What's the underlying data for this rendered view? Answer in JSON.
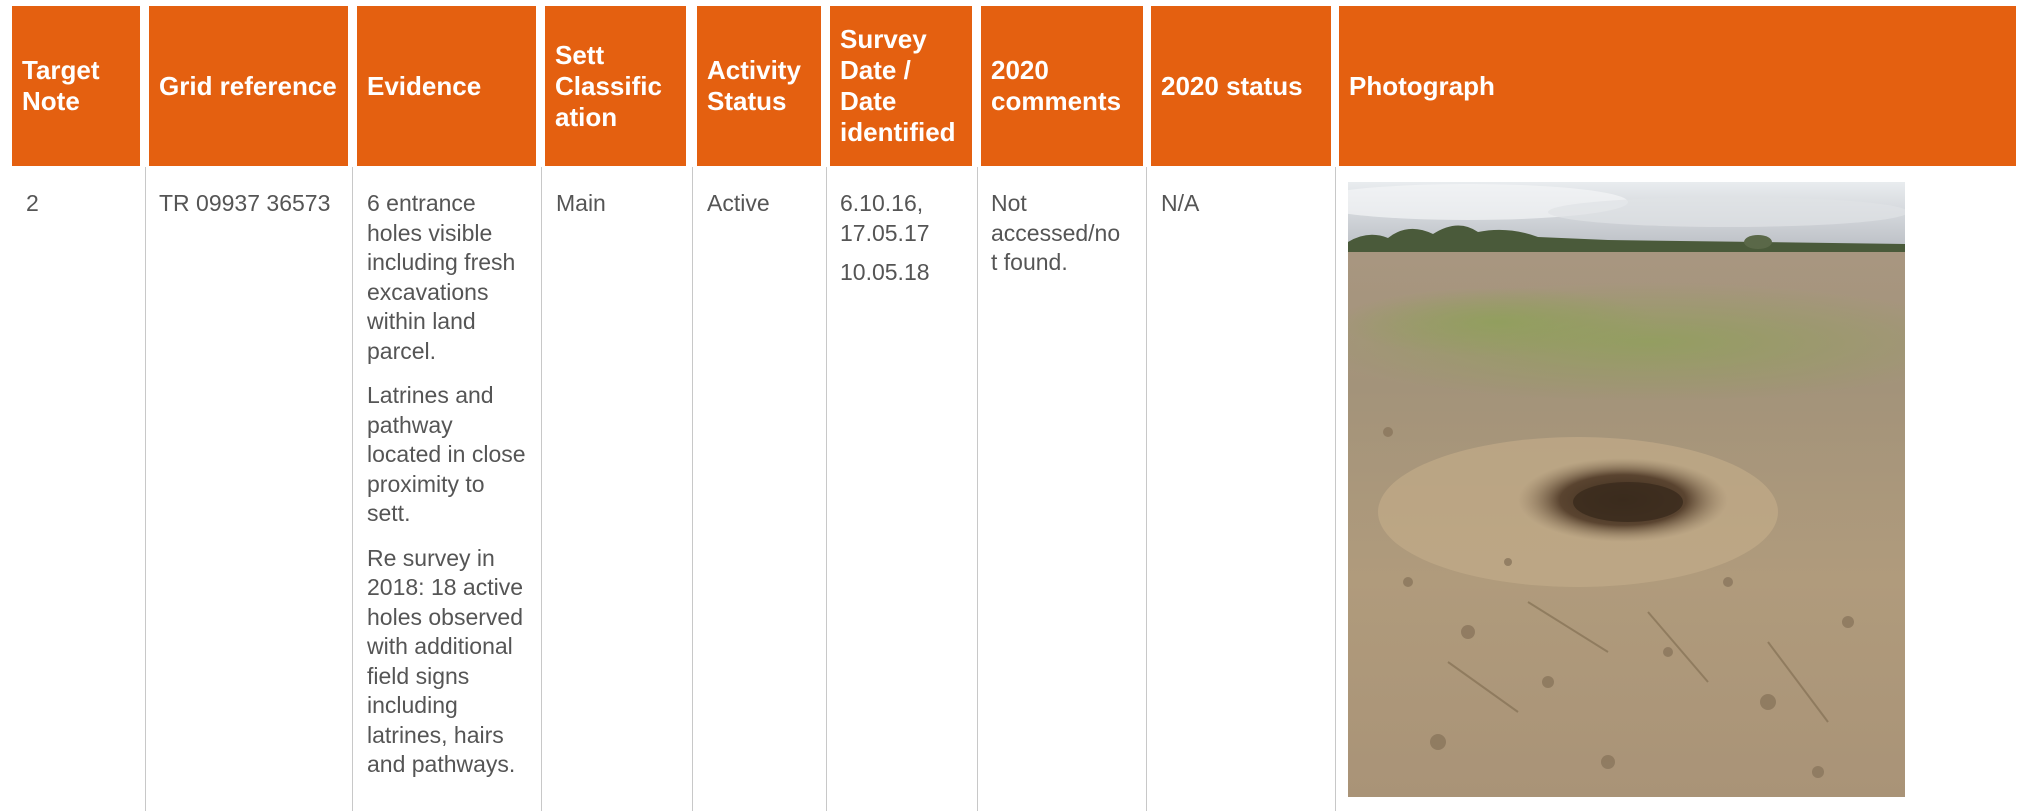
{
  "headers": {
    "target_note": "Target Note",
    "grid_reference": "Grid reference",
    "evidence": "Evidence",
    "sett_classification": "Sett Classific ation",
    "activity_status": "Activity Status",
    "survey_date": "Survey Date / Date identified",
    "comments_2020": "2020 comments",
    "status_2020": "2020 status",
    "photograph": "Photograph"
  },
  "row": {
    "target_note": "2",
    "grid_reference": "TR 09937 36573",
    "evidence": [
      "6 entrance holes visible including fresh excavations within land parcel.",
      "Latrines and pathway located in close proximity to sett.",
      "Re survey in 2018: 18 active holes observed with additional field signs including latrines, hairs and pathways."
    ],
    "sett_classification": "Main",
    "activity_status": "Active",
    "survey_date": [
      "6.10.16, 17.05.17",
      "10.05.18"
    ],
    "comments_2020": "Not accessed/no t found.",
    "status_2020": "N/A"
  },
  "colors": {
    "header_bg": "#e46010",
    "header_text": "#ffffff",
    "body_text": "#555555",
    "grid_line": "#c8c8c8"
  }
}
